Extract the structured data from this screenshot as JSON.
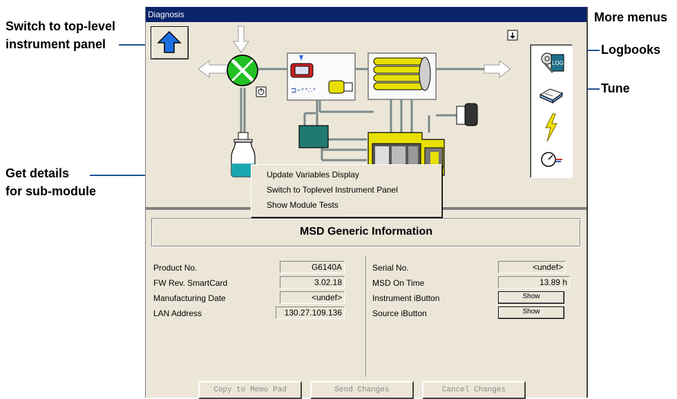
{
  "callouts": {
    "top_level_line1": "Switch to top-level",
    "top_level_line2": "instrument panel",
    "more_menus": "More menus",
    "logbooks": "Logbooks",
    "tune": "Tune",
    "details_line1": "Get details",
    "details_line2": "for sub-module"
  },
  "window": {
    "title": "Diagnosis"
  },
  "context_menu": {
    "items": [
      "Update Variables Display",
      "Switch to Toplevel Instrument Panel",
      "Show Module Tests"
    ]
  },
  "info": {
    "heading": "MSD Generic Information",
    "left": [
      {
        "label": "Product No.",
        "value": "G6140A"
      },
      {
        "label": "FW Rev. SmartCard",
        "value": "3.02.18"
      },
      {
        "label": "Manufacturing Date",
        "value": "<undef>"
      },
      {
        "label": "LAN Address",
        "value": "130.27.109.136"
      }
    ],
    "right": [
      {
        "label": "Serial No.",
        "value": "<undef>"
      },
      {
        "label": "MSD On Time",
        "value": "13.89 h"
      },
      {
        "label": "Instrument iButton",
        "button": "Show"
      },
      {
        "label": "Source iButton",
        "button": "Show"
      }
    ]
  },
  "buttons": {
    "copy": "Copy to Memo Pad",
    "send": "Send Changes",
    "cancel": "Cancel Changes"
  },
  "colors": {
    "titlebar": "#0a246a",
    "valve_green": "#22c022",
    "liquid_teal": "#1aa7b0",
    "lamp_yellow": "#e8e000",
    "callout_line": "#1d4f91"
  }
}
